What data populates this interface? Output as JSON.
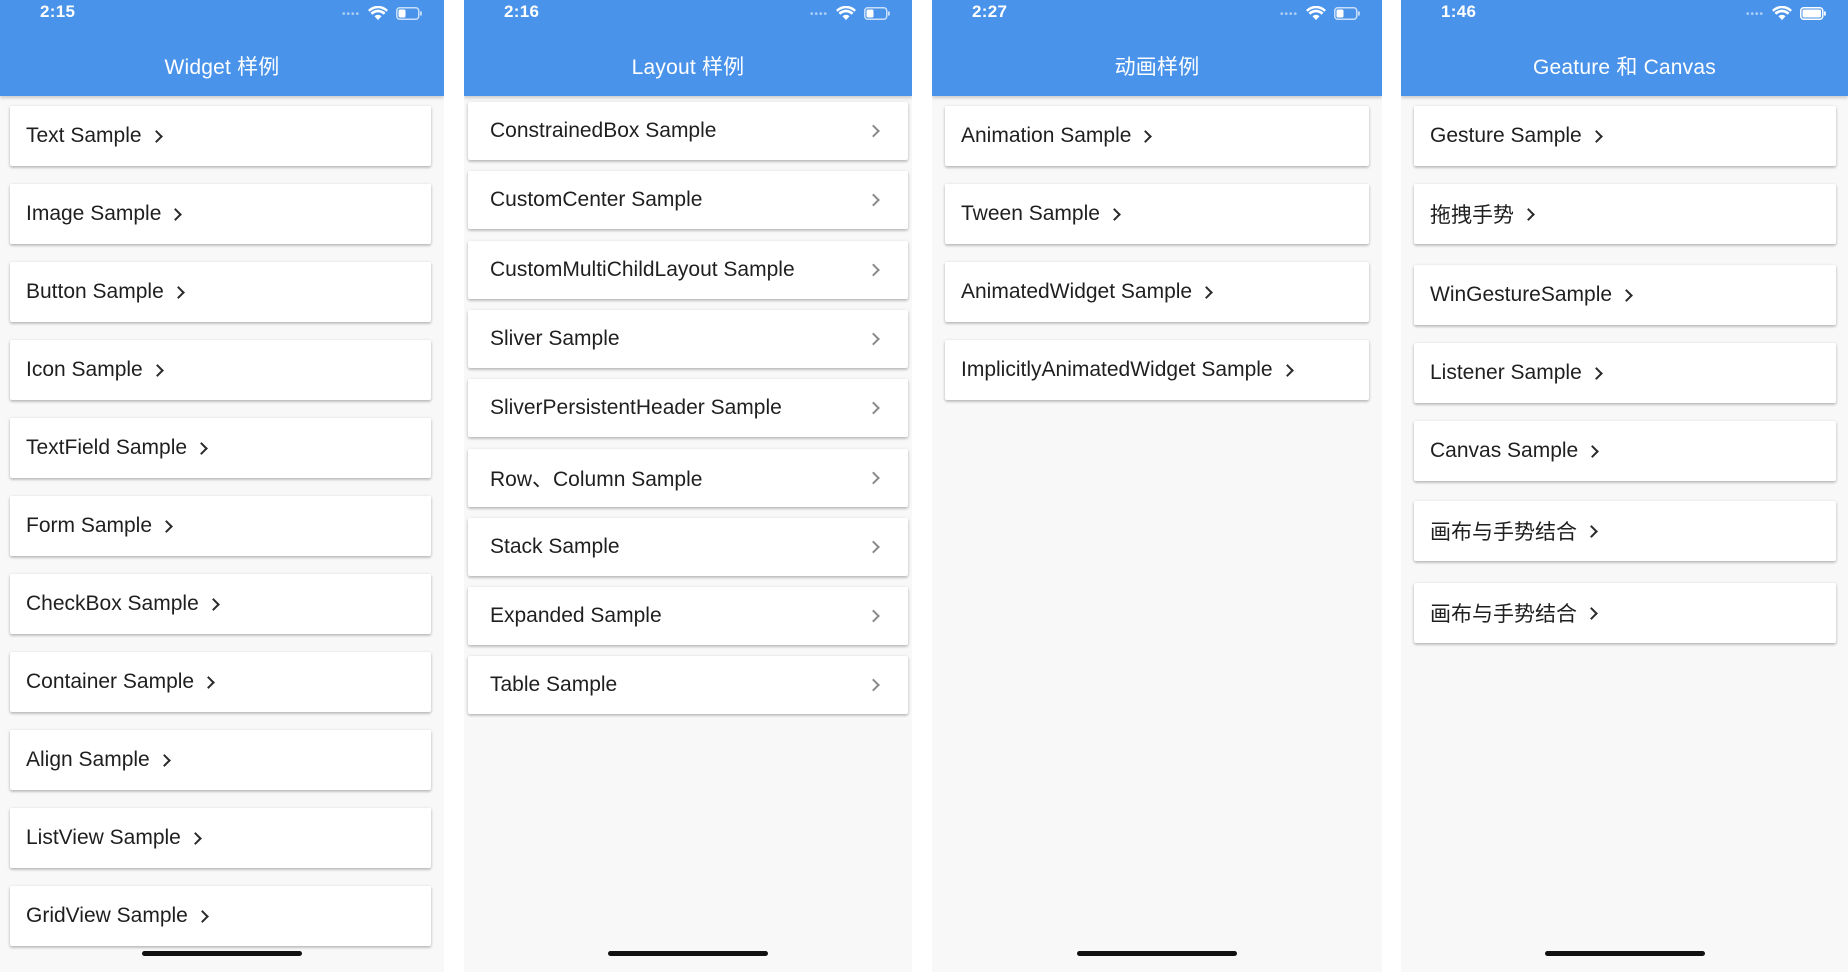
{
  "screens": [
    {
      "status_time": "2:15",
      "title": "Widget 样例",
      "items": [
        "Text Sample",
        "Image Sample",
        "Button Sample",
        "Icon Sample",
        "TextField Sample",
        "Form Sample",
        "CheckBox Sample",
        "Container Sample",
        "Align Sample",
        "ListView Sample",
        "GridView Sample"
      ]
    },
    {
      "status_time": "2:16",
      "title": "Layout 样例",
      "items": [
        "ConstrainedBox Sample",
        "CustomCenter Sample",
        "CustomMultiChildLayout Sample",
        "Sliver Sample",
        "SliverPersistentHeader Sample",
        "Row、Column Sample",
        "Stack Sample",
        "Expanded Sample",
        "Table Sample"
      ]
    },
    {
      "status_time": "2:27",
      "title": "动画样例",
      "items": [
        "Animation Sample",
        "Tween Sample",
        "AnimatedWidget Sample",
        "ImplicitlyAnimatedWidget Sample"
      ]
    },
    {
      "status_time": "1:46",
      "title": "Geature 和 Canvas",
      "items": [
        "Gesture Sample",
        "拖拽手势",
        "WinGestureSample",
        "Listener Sample",
        "Canvas Sample",
        "画布与手势结合",
        "画布与手势结合"
      ]
    }
  ],
  "colors": {
    "appbar": "#4a93ea",
    "background": "#f8f8f8",
    "card": "#ffffff",
    "text": "#1f1f1f"
  },
  "icons": {
    "status": [
      "signal-dots-icon",
      "wifi-icon",
      "battery-icon"
    ],
    "list_item": "chevron-right-icon"
  }
}
